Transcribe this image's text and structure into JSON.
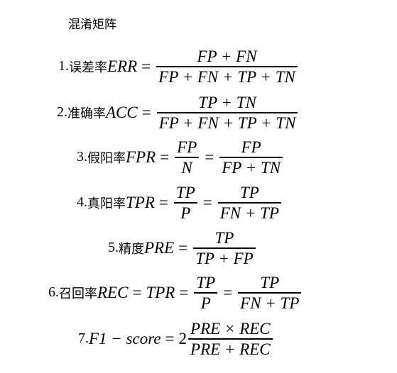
{
  "title": "混淆矩阵",
  "formulas": [
    {
      "num": "1.",
      "cn": "误差率",
      "lhs": "ERR",
      "eq": "=",
      "num1": "FP + FN",
      "den1": "FP + FN + TP + TN"
    },
    {
      "num": "2.",
      "cn": "准确率",
      "lhs": "ACC",
      "eq": "=",
      "num1": "TP + TN",
      "den1": "FP + FN + TP + TN"
    },
    {
      "num": "3.",
      "cn": "假阳率",
      "lhs": "FPR",
      "eq": "=",
      "num1": "FP",
      "den1": "N",
      "eq2": "=",
      "num2": "FP",
      "den2": "FP + TN"
    },
    {
      "num": "4.",
      "cn": "真阳率",
      "lhs": "TPR",
      "eq": "=",
      "num1": "TP",
      "den1": "P",
      "eq2": "=",
      "num2": "TP",
      "den2": "FN + TP"
    },
    {
      "num": "5.",
      "cn": "精度",
      "lhs": "PRE",
      "eq": "=",
      "num1": "TP",
      "den1": "TP + FP"
    },
    {
      "num": "6.",
      "cn": "召回率",
      "lhs": "REC",
      "eq": "=",
      "mid": "TPR",
      "eq2": "=",
      "num1": "TP",
      "den1": "P",
      "eq3": "=",
      "num2": "TP",
      "den2": "FN + TP"
    },
    {
      "num": "7.",
      "lhs": "F1 − score",
      "eq": "=",
      "coef": "2",
      "num1": "PRE × REC",
      "den1": "PRE + REC"
    }
  ]
}
